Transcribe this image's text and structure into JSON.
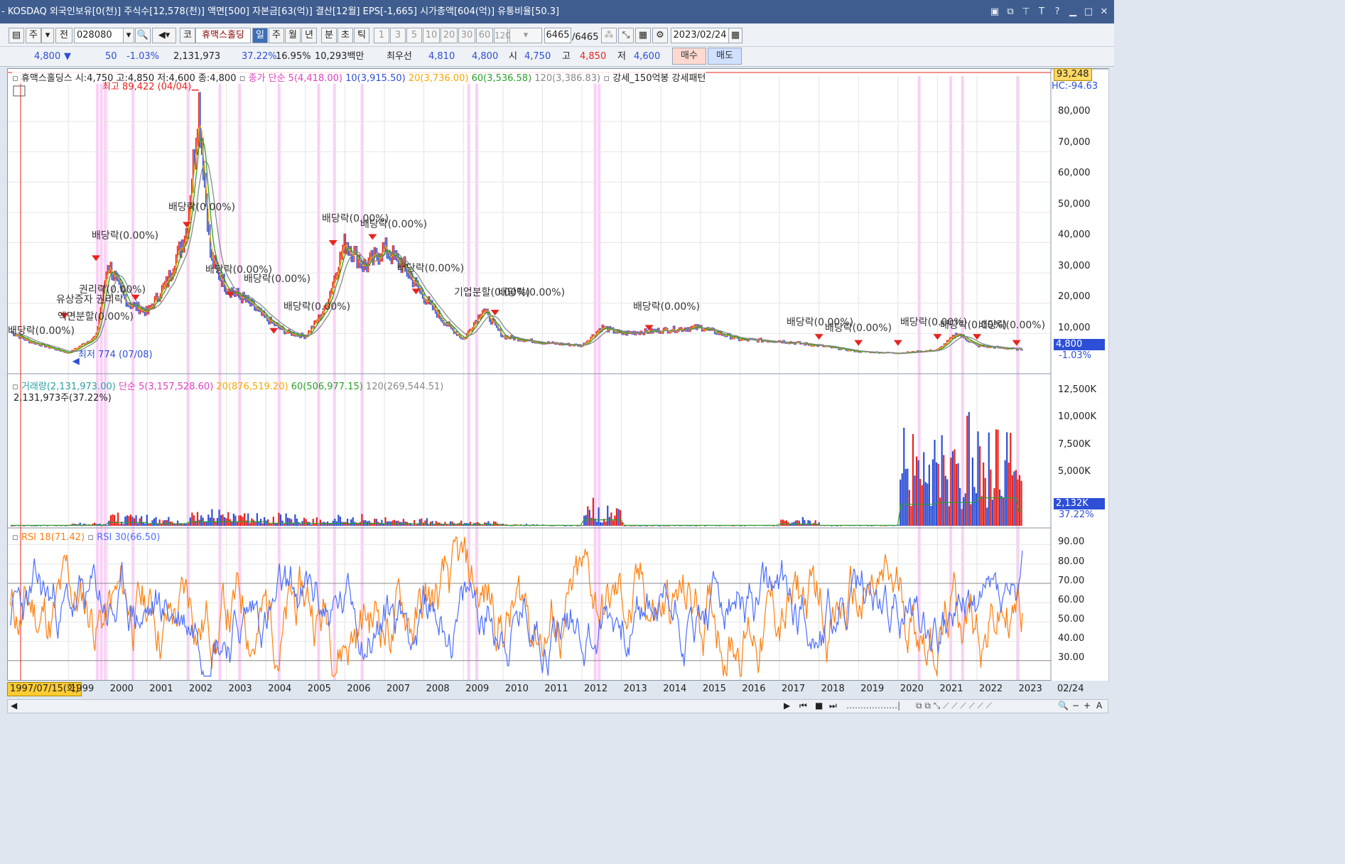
{
  "window": {
    "title": "- KOSDAQ 외국인보유[0(천)] 주식수[12,578(천)] 액면[500] 자본금[63(억)] 결산[12월] EPS[-1,665] 시가총액[604(억)] 유통비율[50.3]",
    "icons": [
      "layout-icon",
      "window-icon",
      "pin-icon",
      "font-icon",
      "help-icon",
      "minimize-icon",
      "maximize-icon",
      "close-icon"
    ]
  },
  "toolbar": {
    "mode1": "주",
    "mode2": "전",
    "code": "028080",
    "market": "코",
    "name": "휴맥스홀딩",
    "periods": [
      "일",
      "주",
      "월",
      "년",
      "분",
      "초",
      "틱"
    ],
    "selected_period": "일",
    "intervals": [
      "1",
      "3",
      "5",
      "10",
      "20",
      "30",
      "60",
      "120"
    ],
    "count": "6465",
    "total": "/6465",
    "date": "2023/02/24"
  },
  "quote": {
    "price": "4,800",
    "arrow": "▼",
    "change": "50",
    "pct": "-1.03%",
    "volume": "2,131,973",
    "vol_ratio": "37.22%",
    "turnover": "16.95%",
    "amount": "10,293백만",
    "best_label": "최우선",
    "best_ask": "4,810",
    "best_bid": "4,800",
    "open_label": "시",
    "open": "4,750",
    "high_label": "고",
    "high": "4,850",
    "low_label": "저",
    "low": "4,600",
    "buy": "매수",
    "sell": "매도"
  },
  "panel1": {
    "legend_name": "휴맥스홀딩스 시:4,750 고:4,850 저:4,600 종:4,800",
    "ma_label": "종가 단순 5(4,418.00)",
    "ma10": "10(3,915.50)",
    "ma20": "20(3,736.00)",
    "ma60": "60(3,536.58)",
    "ma120": "120(3,386.83)",
    "pattern": "강세_150억봉 강세패턴",
    "max_label": "최고 89,422 (04/04)",
    "min_label": "최저 774 (07/08)",
    "top_value": "93,248",
    "hc_label": "HC:-94.63",
    "last_price": "4,800",
    "last_pct": "-1.03%",
    "y_ticks": [
      "80,000",
      "70,000",
      "60,000",
      "50,000",
      "40,000",
      "30,000",
      "20,000",
      "10,000"
    ],
    "events": [
      {
        "text": "배당락(0.00%)"
      },
      {
        "text": "배당락(0.00%)"
      },
      {
        "text": "권리락(0.00%)"
      },
      {
        "text": "유상증자 권리락"
      },
      {
        "text": "액면분할(0.00%)"
      },
      {
        "text": "배당락(0.00%)"
      },
      {
        "text": "배당락(0.00%)"
      },
      {
        "text": "배당락(0.00%)"
      },
      {
        "text": "배당락(0.00%)"
      },
      {
        "text": "배당락(0.00%)"
      },
      {
        "text": "배당락(0.00%)"
      },
      {
        "text": "배당락(0.00%)"
      },
      {
        "text": "기업분할(0.00%)"
      },
      {
        "text": "배당락(0.00%)"
      },
      {
        "text": "배당락(0.00%)"
      },
      {
        "text": "배당락(0.00%)"
      },
      {
        "text": "배당락(0.00%)"
      },
      {
        "text": "배당락(0.00%)"
      },
      {
        "text": "배당락(0.00%)"
      },
      {
        "text": "배당락(0.00%)"
      }
    ]
  },
  "panel2": {
    "legend_volume": "거래량(2,131,973.00)",
    "ma5": "단순 5(3,157,528.60)",
    "ma20": "20(876,519.20)",
    "ma60": "60(506,977.15)",
    "ma120": "120(269,544.51)",
    "shares": "2,131,973주(37.22%)",
    "y_ticks": [
      "12,500K",
      "10,000K",
      "7,500K",
      "5,000K"
    ],
    "last_vol": "2,132K",
    "last_pct": "37.22%"
  },
  "panel3": {
    "rsi18": "RSI 18(71.42)",
    "rsi30": "RSI 30(66.50)",
    "y_ticks": [
      "90.00",
      "80.00",
      "70.00",
      "60.00",
      "50.00",
      "40.00",
      "30.00"
    ]
  },
  "xaxis": {
    "start_date": "1997/07/15(화)",
    "years": [
      "1999",
      "2000",
      "2001",
      "2002",
      "2003",
      "2004",
      "2005",
      "2006",
      "2007",
      "2008",
      "2009",
      "2010",
      "2011",
      "2012",
      "2013",
      "2014",
      "2015",
      "2016",
      "2017",
      "2018",
      "2019",
      "2020",
      "2021",
      "2022",
      "2023"
    ],
    "end": "02/24"
  },
  "colors": {
    "up": "#e8231d",
    "down": "#2d4fd6",
    "ma5": "#e040c0",
    "ma10": "#2d4fd6",
    "ma20": "#f5a800",
    "ma60": "#2ca02c",
    "ma120": "#888888",
    "highlight": "#f7c6f2",
    "rsi18": "#ff7f0e",
    "rsi30": "#4c6fff"
  },
  "chart_data": [
    {
      "type": "line",
      "title": "휴맥스홀딩스",
      "note": "approximate daily close price path, KRW",
      "x": [
        "1997",
        "1998",
        "1999",
        "1999.7",
        "2000",
        "2000.5",
        "2001",
        "2001.5",
        "2002",
        "2002.3",
        "2002.6",
        "2003",
        "2003.5",
        "2004",
        "2004.5",
        "2005",
        "2005.5",
        "2006",
        "2006.5",
        "2007",
        "2007.5",
        "2008",
        "2008.5",
        "2009",
        "2009.5",
        "2010",
        "2011",
        "2012",
        "2012.5",
        "2013",
        "2014",
        "2015",
        "2016",
        "2017",
        "2018",
        "2019",
        "2020",
        "2021",
        "2021.5",
        "2022",
        "2023"
      ],
      "series": [
        {
          "name": "종가",
          "values": [
            14000,
            7500,
            3500,
            9000,
            33000,
            20000,
            17000,
            27000,
            44000,
            85000,
            35000,
            25000,
            21000,
            15000,
            10500,
            9000,
            18000,
            40000,
            32000,
            38000,
            32000,
            22000,
            14000,
            8000,
            18000,
            9000,
            7000,
            6000,
            12000,
            10000,
            11000,
            12000,
            8000,
            7500,
            6000,
            4000,
            3500,
            4500,
            10000,
            6000,
            4800
          ]
        }
      ],
      "ylim": [
        0,
        95000
      ]
    },
    {
      "type": "bar",
      "title": "거래량",
      "note": "approximate volume, thousands of shares",
      "categories": [
        "1999",
        "2000",
        "2001",
        "2002",
        "2003",
        "2004",
        "2005",
        "2006",
        "2007",
        "2008",
        "2009",
        "2010",
        "2012",
        "2017",
        "2020",
        "2021",
        "2022",
        "2023"
      ],
      "values": [
        300,
        1500,
        900,
        1800,
        1900,
        1200,
        1100,
        1100,
        900,
        700,
        600,
        200,
        2700,
        800,
        9700,
        10500,
        12600,
        6500
      ],
      "ylim": [
        0,
        13000
      ]
    },
    {
      "type": "line",
      "title": "RSI",
      "series": [
        {
          "name": "RSI 18",
          "last": 71.42
        },
        {
          "name": "RSI 30",
          "last": 66.5
        }
      ],
      "ylim": [
        20,
        95
      ]
    }
  ]
}
